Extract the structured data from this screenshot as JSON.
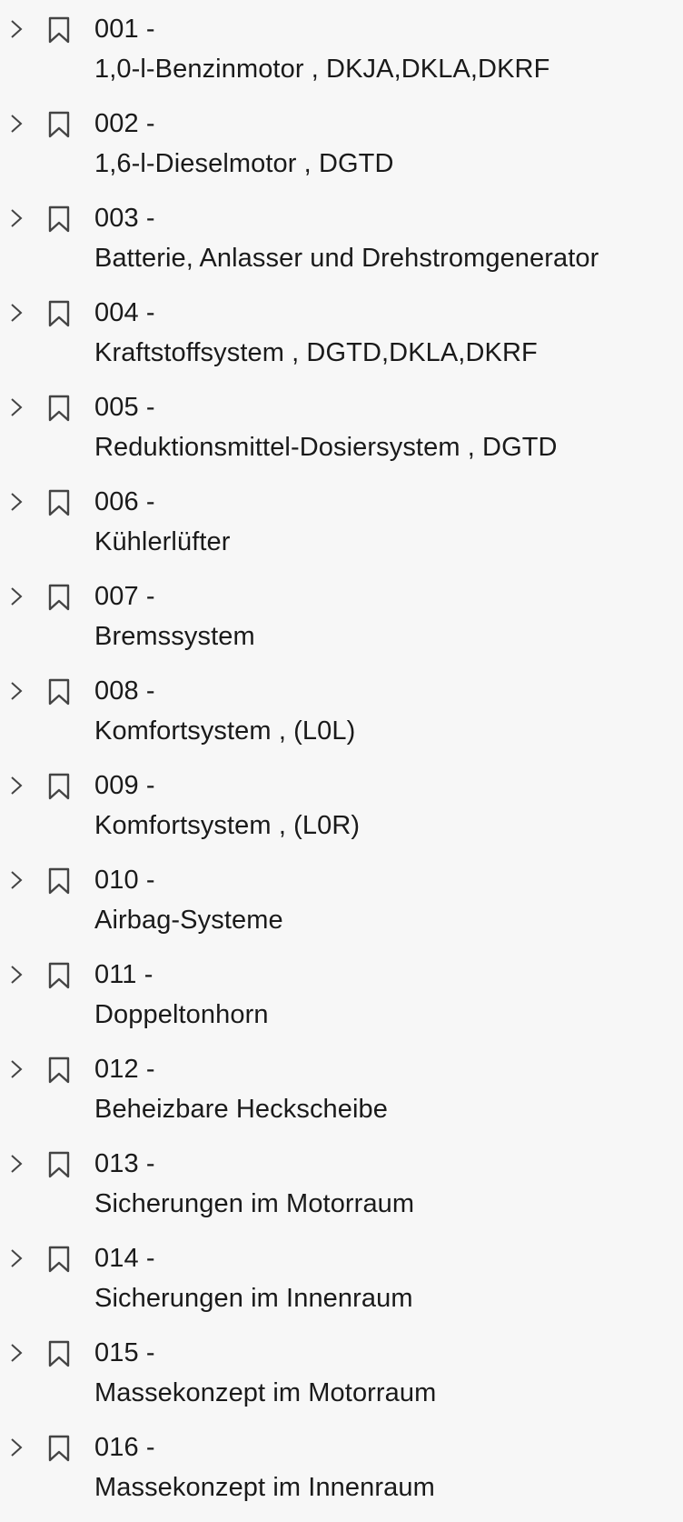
{
  "bookmarks": {
    "items": [
      {
        "number": "001 -",
        "title": "1,0-l-Benzinmotor , DKJA,DKLA,DKRF"
      },
      {
        "number": "002 -",
        "title": "1,6-l-Dieselmotor , DGTD"
      },
      {
        "number": "003 -",
        "title": "Batterie, Anlasser und Drehstromgenerator"
      },
      {
        "number": "004 -",
        "title": "Kraftstoffsystem , DGTD,DKLA,DKRF"
      },
      {
        "number": "005 -",
        "title": "Reduktionsmittel-Dosiersystem , DGTD"
      },
      {
        "number": "006 -",
        "title": "Kühlerlüfter"
      },
      {
        "number": "007 -",
        "title": "Bremssystem"
      },
      {
        "number": "008 -",
        "title": "Komfortsystem , (L0L)"
      },
      {
        "number": "009 -",
        "title": "Komfortsystem , (L0R)"
      },
      {
        "number": "010 -",
        "title": "Airbag-Systeme"
      },
      {
        "number": "011 -",
        "title": "Doppeltonhorn"
      },
      {
        "number": "012 -",
        "title": "Beheizbare Heckscheibe"
      },
      {
        "number": "013 -",
        "title": "Sicherungen im Motorraum"
      },
      {
        "number": "014 -",
        "title": "Sicherungen im Innenraum"
      },
      {
        "number": "015 -",
        "title": "Massekonzept im Motorraum"
      },
      {
        "number": "016 -",
        "title": "Massekonzept im Innenraum"
      }
    ],
    "expand_icon": "chevron-right-icon",
    "bookmark_icon": "bookmark-icon"
  }
}
